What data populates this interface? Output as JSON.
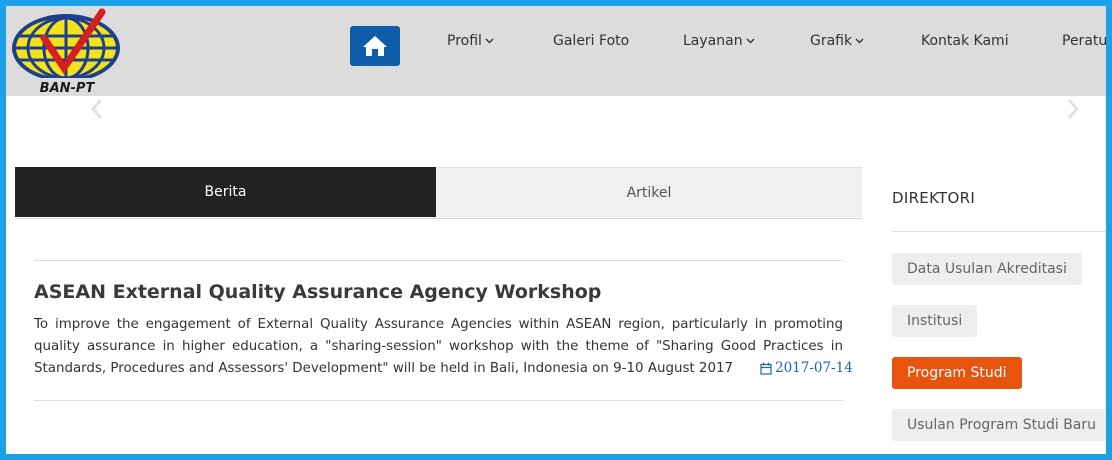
{
  "header": {
    "logo_text": "BAN-PT",
    "nav": [
      {
        "label": "Profil",
        "dropdown": true
      },
      {
        "label": "Galeri Foto",
        "dropdown": false
      },
      {
        "label": "Layanan",
        "dropdown": true
      },
      {
        "label": "Grafik",
        "dropdown": true
      },
      {
        "label": "Kontak Kami",
        "dropdown": false
      },
      {
        "label": "Peratu",
        "dropdown": false
      }
    ],
    "home_icon": "home-icon"
  },
  "tabs": [
    {
      "label": "Berita",
      "active": true
    },
    {
      "label": "Artikel",
      "active": false
    }
  ],
  "news": {
    "title": "ASEAN External Quality Assurance Agency Workshop",
    "body": "To improve the engagement of External Quality Assurance Agencies within ASEAN region, particularly in promoting quality assurance in higher education, a \"sharing-session\" workshop with the theme of \"Sharing Good Practices in Standards, Procedures and Assessors' Development\" will be held in Bali, Indonesia on 9-10 August 2017",
    "date": "2017-07-14",
    "date_icon": "calendar-icon"
  },
  "directory": {
    "title": "DIREKTORI",
    "items": [
      {
        "label": "Data Usulan Akreditasi",
        "active": false
      },
      {
        "label": "Institusi",
        "active": false
      },
      {
        "label": "Program Studi",
        "active": true
      },
      {
        "label": "Usulan Program Studi Baru",
        "active": false
      }
    ]
  },
  "colors": {
    "page_border": "#1aa1e8",
    "header_bg": "#dcdcdc",
    "home_button": "#0f5ca8",
    "active_tab": "#222222",
    "active_directory": "#e8530e",
    "date_link": "#1d64a8"
  }
}
